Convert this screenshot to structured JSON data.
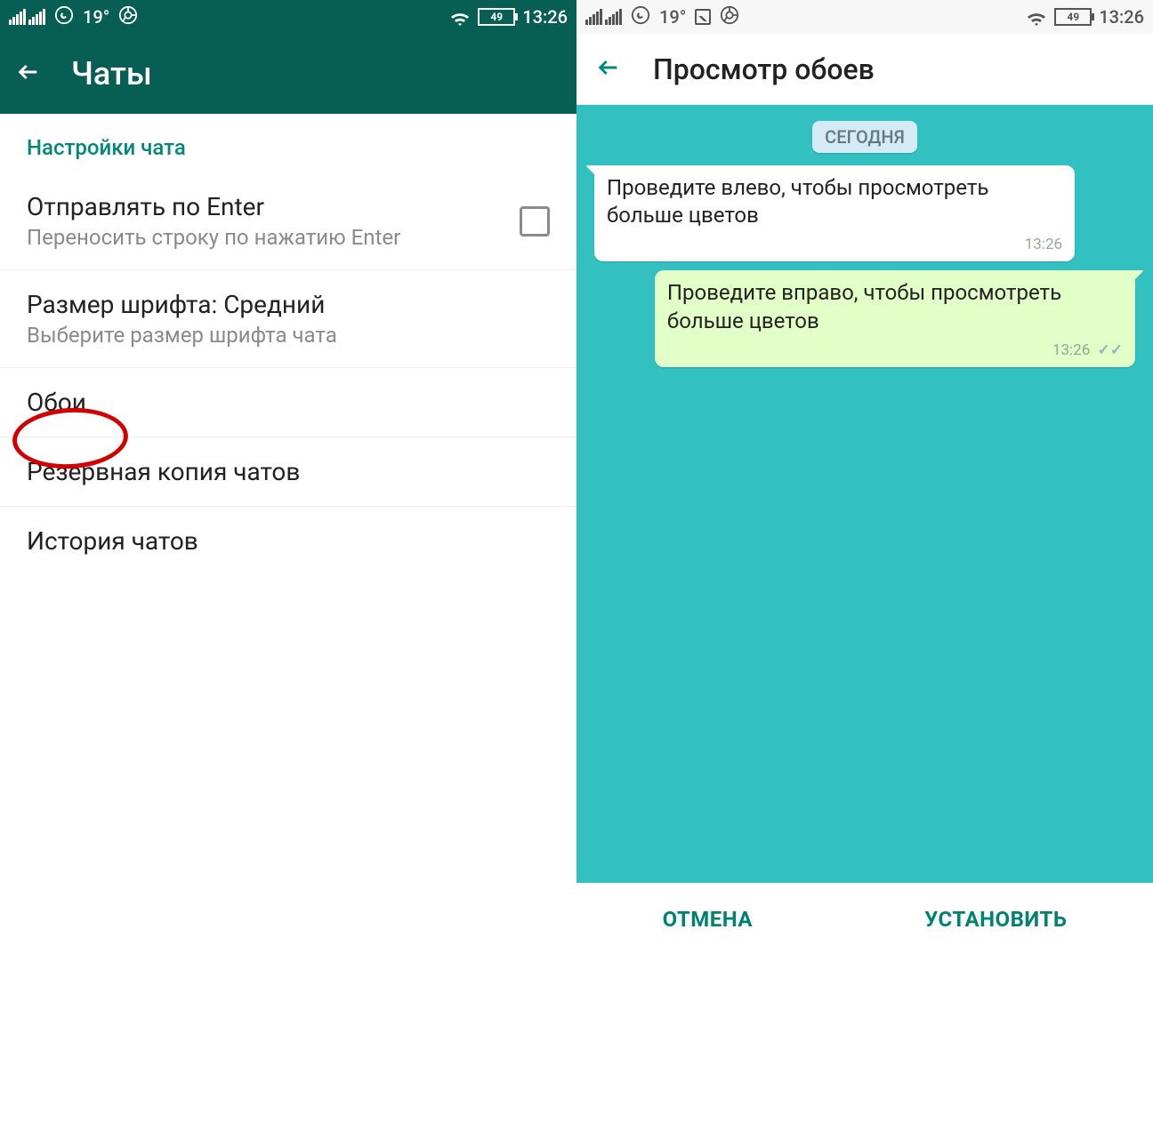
{
  "status": {
    "temperature": "19°",
    "battery": "49",
    "time": "13:26"
  },
  "left": {
    "title": "Чаты",
    "section_header": "Настройки чата",
    "rows": {
      "enter": {
        "title": "Отправлять по Enter",
        "sub": "Переносить строку по нажатию Enter"
      },
      "font": {
        "title": "Размер шрифта: Средний",
        "sub": "Выберите размер шрифта чата"
      },
      "wallpaper": {
        "title": "Обои"
      },
      "backup": {
        "title": "Резервная копия чатов"
      },
      "history": {
        "title": "История чатов"
      }
    }
  },
  "right": {
    "title": "Просмотр обоев",
    "date_chip": "СЕГОДНЯ",
    "msg_in": {
      "text": "Проведите влево, чтобы просмотреть больше цветов",
      "time": "13:26"
    },
    "msg_out": {
      "text": "Проведите вправо, чтобы просмотреть больше цветов",
      "time": "13:26"
    },
    "footer": {
      "cancel": "ОТМЕНА",
      "set": "УСТАНОВИТЬ"
    }
  }
}
